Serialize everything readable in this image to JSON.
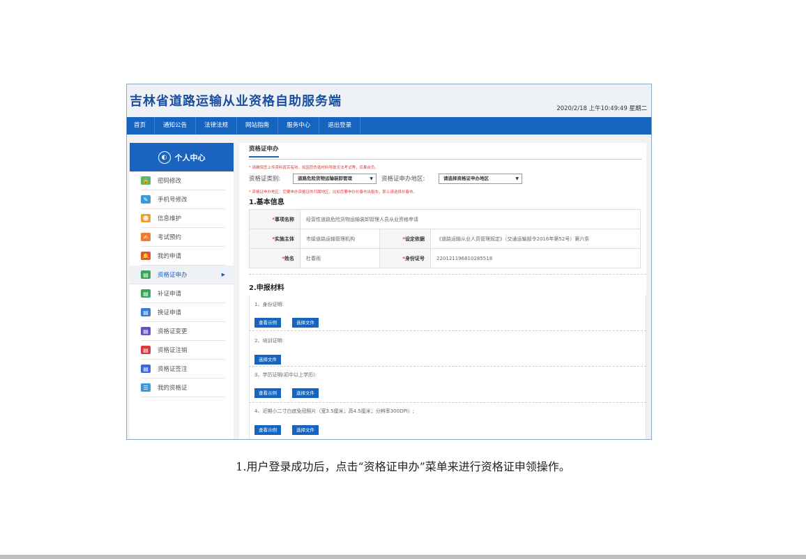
{
  "header": {
    "title": "吉林省道路运输从业资格自助服务端",
    "datetime": "2020/2/18 上午10:49:49 星期二"
  },
  "nav": [
    "首页",
    "通知公告",
    "法律法规",
    "网站指南",
    "服务中心",
    "退出登录"
  ],
  "sidebar": {
    "title": "个人中心",
    "items": [
      {
        "label": "密码修改",
        "icon": "lock-icon",
        "color": "#5cb85c"
      },
      {
        "label": "手机号修改",
        "icon": "edit-icon",
        "color": "#3a9ad9"
      },
      {
        "label": "信息维护",
        "icon": "user-card-icon",
        "color": "#f0a030"
      },
      {
        "label": "考试预约",
        "icon": "calendar-edit-icon",
        "color": "#f07a30"
      },
      {
        "label": "我的申请",
        "icon": "bell-icon",
        "color": "#e8542a"
      },
      {
        "label": "资格证申办",
        "icon": "certificate-add-icon",
        "color": "#3aa65a"
      },
      {
        "label": "补证申请",
        "icon": "certificate-repair-icon",
        "color": "#3aa65a"
      },
      {
        "label": "换证申请",
        "icon": "certificate-swap-icon",
        "color": "#3a7ad9"
      },
      {
        "label": "资格证变更",
        "icon": "certificate-change-icon",
        "color": "#6a4fc8"
      },
      {
        "label": "资格证注销",
        "icon": "certificate-cancel-icon",
        "color": "#d93a3a"
      },
      {
        "label": "资格证签注",
        "icon": "certificate-sign-icon",
        "color": "#3a6ad9"
      },
      {
        "label": "我的资格证",
        "icon": "id-card-icon",
        "color": "#3a9ad9"
      }
    ]
  },
  "main": {
    "tab": "资格证申办",
    "note1": "* 请确保您上传资料真实有效，如因您伪造材料导致无法考试等，后果自负。",
    "cert_type_label": "资格证类别:",
    "cert_type_value": "道路危险货物运输装卸管理",
    "region_label": "资格证申办地区:",
    "region_value": "请选择资格证申办地区",
    "note2": "* 资格证申办地区：您要申办资格证的归属地区，比如您要申办长春市出租车，那么请选择长春市。",
    "section1": "1.基本信息",
    "labels": {
      "item_name": "事项名称",
      "subject": "实施主体",
      "basis": "设定依据",
      "name": "姓名",
      "id_no": "身份证号"
    },
    "values": {
      "item_name": "经营性道路危险货物运输装卸管理人员从业资格申请",
      "subject": "市级道路运输管理机构",
      "basis": "《道路运输从业人员管理规定》（交通运输部令2016年第52号）第六条",
      "name": "杜春雨",
      "id_no": "220121196810285518"
    },
    "section2": "2.申报材料",
    "materials": [
      "1、身份证明:",
      "2、培训证明:",
      "3、学历证明(初中以上学历):",
      "4、近期小二寸白底免冠照片（宽3.5厘米；高4.5厘米；分辨率300DPI）;"
    ],
    "btn_example": "查看示例",
    "btn_choose": "选择文件"
  },
  "caption": "1.用户登录成功后，点击“资格证申办”菜单来进行资格证申领操作。"
}
